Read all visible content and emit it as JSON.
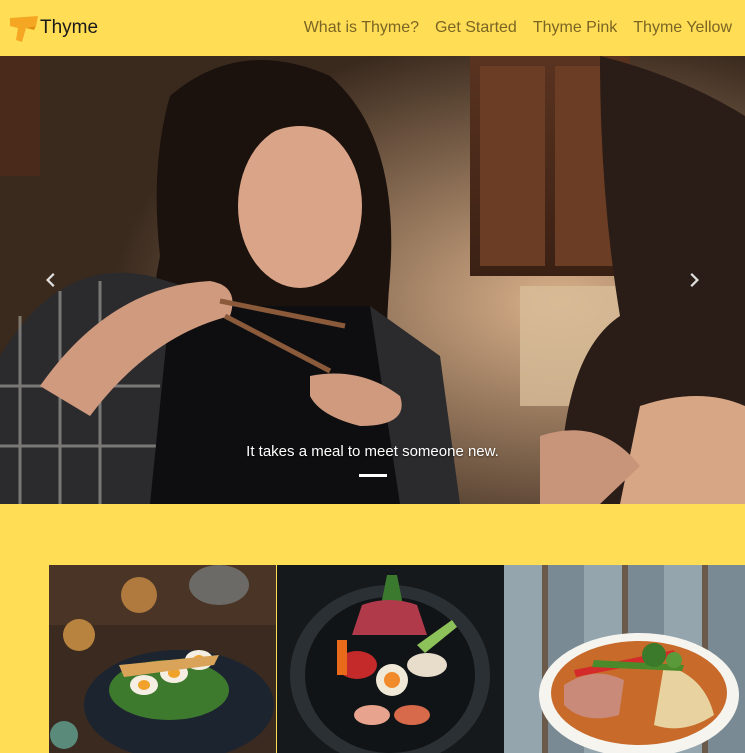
{
  "brand": {
    "name": "Thyme",
    "logo_icon": "thyme-leaf-logo-icon",
    "logo_color": "#f5a623"
  },
  "nav": {
    "links": [
      {
        "label": "What is Thyme?"
      },
      {
        "label": "Get Started"
      },
      {
        "label": "Thyme Pink"
      },
      {
        "label": "Thyme Yellow"
      }
    ]
  },
  "carousel": {
    "caption": "It takes a meal to meet someone new.",
    "prev_icon": "chevron-left-icon",
    "next_icon": "chevron-right-icon",
    "slide_count": 1,
    "active_slide": 1
  },
  "gallery": {
    "tiles": [
      {
        "subject": "eggs-avocado-plate"
      },
      {
        "subject": "sashimi-bowl"
      },
      {
        "subject": "ramen-bowl"
      }
    ]
  },
  "colors": {
    "background": "#ffdd55",
    "nav_link": "#7a6524",
    "brand_text": "#1a1a1a"
  }
}
